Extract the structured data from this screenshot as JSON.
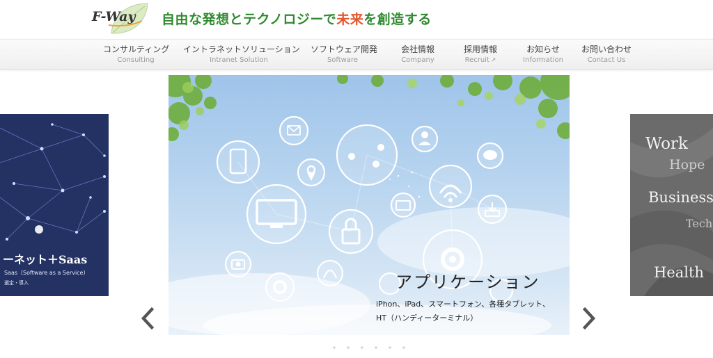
{
  "brand": {
    "logo_text": "F-Way",
    "tagline_part1": "自由な発想とテクノロジーで",
    "tagline_accent": "未来",
    "tagline_part2": "を創造する"
  },
  "nav": {
    "items": [
      {
        "jp": "コンサルティング",
        "en": "Consulting"
      },
      {
        "jp": "イントラネットソリューション",
        "en": "Intranet Solution"
      },
      {
        "jp": "ソフトウェア開発",
        "en": "Software"
      },
      {
        "jp": "会社情報",
        "en": "Company"
      },
      {
        "jp": "採用情報",
        "en": "Recruit"
      },
      {
        "jp": "お知らせ",
        "en": "Information"
      },
      {
        "jp": "お問い合わせ",
        "en": "Contact Us"
      }
    ]
  },
  "carousel": {
    "main": {
      "title": "アプリケーション",
      "desc_line1": "iPhon、iPad、スマートフォン、各種タブレット、",
      "desc_line2": "HT（ハンディーターミナル）"
    },
    "left": {
      "title": "ーネット＋Saas",
      "sub": "Saas（Software as a Service）",
      "sub2": "選定・導入"
    },
    "right": {
      "words": [
        "Work",
        "Hope",
        "Business",
        "Tech",
        "Health"
      ]
    },
    "prev_icon": "chevron-left-icon",
    "next_icon": "chevron-right-icon"
  },
  "colors": {
    "tagline_green": "#2f8a2f",
    "tagline_accent": "#e4572e"
  }
}
